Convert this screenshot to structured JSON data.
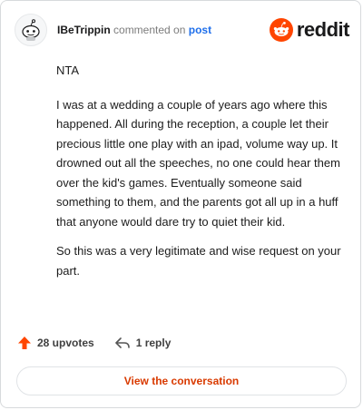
{
  "header": {
    "username": "IBeTrippin",
    "commented_on": "commented on",
    "post_link": "post",
    "brand": "reddit",
    "avatar_icon": "reddit-snoo-avatar-icon",
    "brand_color": "#ff4500"
  },
  "comment": {
    "paragraphs": [
      "NTA",
      "I was at a wedding a couple of years ago where this happened. All during the reception, a couple let their precious little one play with an ipad, volume way up. It drowned out all the speeches, no one could hear them over the kid's games. Eventually someone said something to them, and the parents got all up in a huff that anyone would dare try to quiet their kid.",
      "So this was a very legitimate and wise request on your part."
    ]
  },
  "actions": {
    "upvotes": "28 upvotes",
    "upvote_icon": "upvote-arrow-icon",
    "upvote_color": "#ff4500",
    "replies": "1 reply",
    "reply_icon": "reply-arrow-icon"
  },
  "cta": {
    "label": "View the conversation",
    "color": "#d93a00"
  }
}
